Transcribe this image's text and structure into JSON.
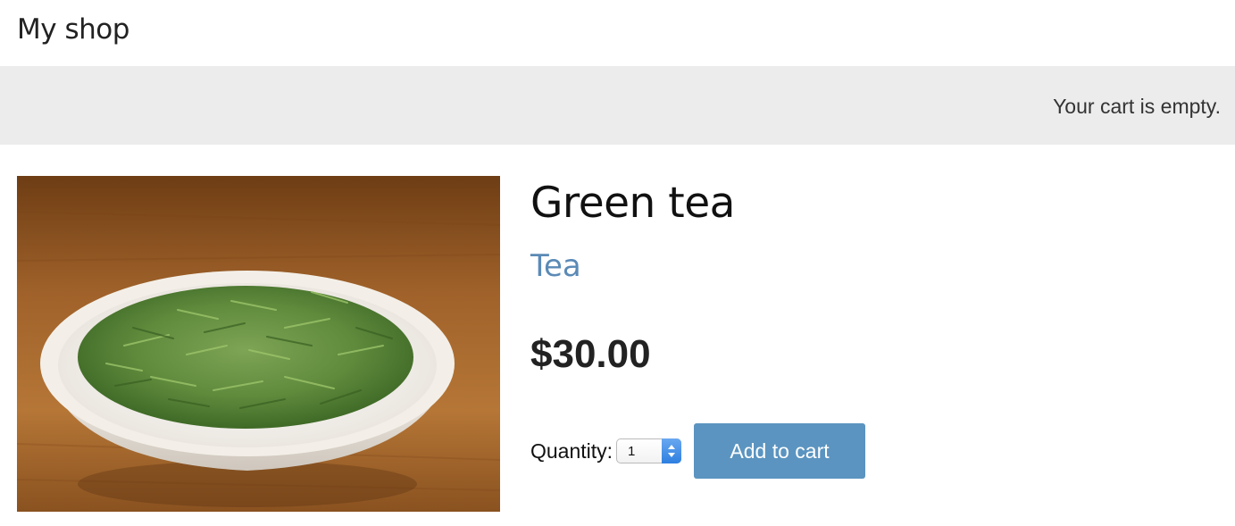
{
  "header": {
    "logo_text": "My shop"
  },
  "cart": {
    "status_text": "Your cart is empty."
  },
  "product": {
    "title": "Green tea",
    "category": "Tea",
    "price": "$30.00",
    "image_icon": "product-photo-green-tea-bowl"
  },
  "form": {
    "quantity_label": "Quantity:",
    "quantity_value": "1",
    "add_button_label": "Add to cart"
  },
  "colors": {
    "accent_link": "#5b8ab6",
    "button_bg": "#5b94c0",
    "subheader_bg": "#ececec"
  }
}
